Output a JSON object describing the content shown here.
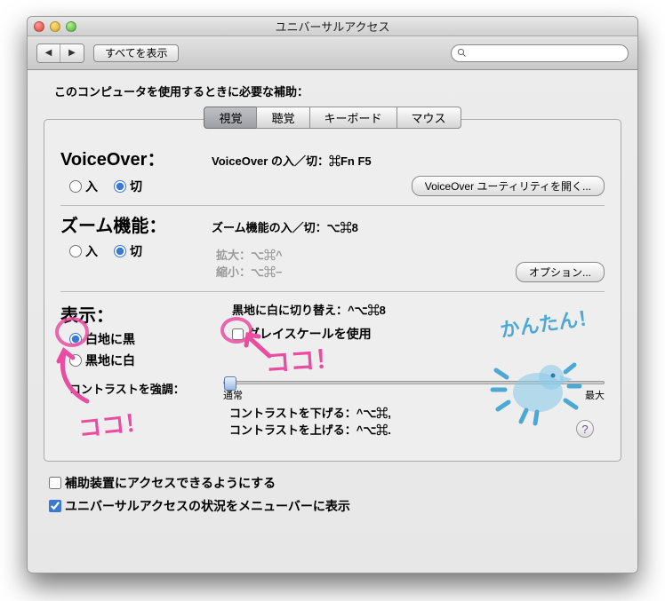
{
  "window": {
    "title": "ユニバーサルアクセス"
  },
  "toolbar": {
    "back_icon": "◀",
    "forward_icon": "▶",
    "show_all": "すべてを表示",
    "search_placeholder": ""
  },
  "intro": "このコンピュータを使用するときに必要な補助：",
  "tabs": {
    "items": [
      {
        "label": "視覚",
        "active": true
      },
      {
        "label": "聴覚",
        "active": false
      },
      {
        "label": "キーボード",
        "active": false
      },
      {
        "label": "マウス",
        "active": false
      }
    ]
  },
  "voiceover": {
    "heading": "VoiceOver：",
    "subtitle": "VoiceOver の入／切：⌘Fn F5",
    "on_label": "入",
    "off_label": "切",
    "selected": "off",
    "open_util": "VoiceOver ユーティリティを開く..."
  },
  "zoom": {
    "heading": "ズーム機能：",
    "toggle_help": "ズーム機能の入／切：⌥⌘8",
    "on_label": "入",
    "off_label": "切",
    "selected": "off",
    "zoom_in": "拡大：⌥⌘^",
    "zoom_out": "縮小：⌥⌘−",
    "options": "オプション..."
  },
  "display": {
    "heading": "表示：",
    "invert_help": "黒地に白に切り替え：^⌥⌘8",
    "radio_black_on_white": "白地に黒",
    "radio_white_on_black": "黒地に白",
    "radio_selected": "black_on_white",
    "grayscale_label": "グレイスケールを使用",
    "grayscale_checked": false,
    "contrast_label": "コントラストを強調：",
    "slider_min": "通常",
    "slider_max": "最大",
    "contrast_down": "コントラストを下げる：^⌥⌘,",
    "contrast_up": "コントラストを上げる：^⌥⌘."
  },
  "help_icon": "?",
  "footer": {
    "assistive": {
      "label": "補助装置にアクセスできるようにする",
      "checked": false
    },
    "menubar": {
      "label": "ユニバーサルアクセスの状況をメニューバーに表示",
      "checked": true
    }
  },
  "annotations": {
    "koko1": "ココ！",
    "koko2": "ココ！",
    "kantan": "かんたん！"
  }
}
